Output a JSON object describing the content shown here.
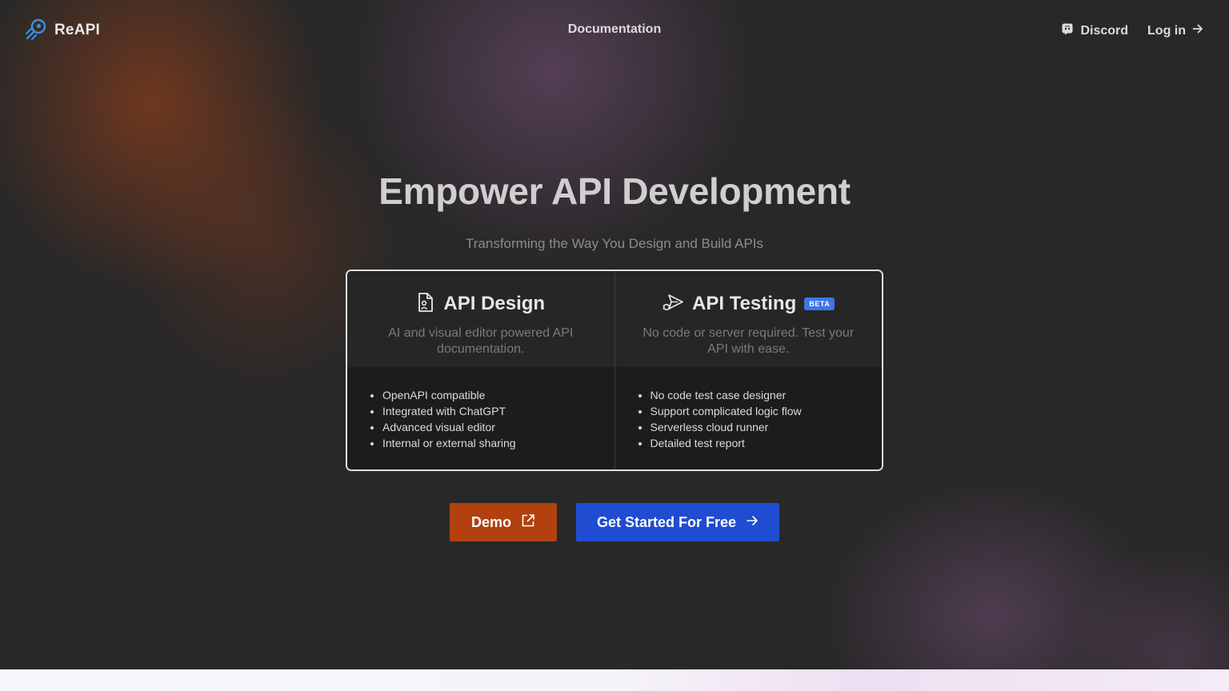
{
  "nav": {
    "logo_text": "ReAPI",
    "documentation": "Documentation",
    "discord": "Discord",
    "login": "Log in"
  },
  "hero": {
    "title": "Empower API Development",
    "subtitle": "Transforming the Way You Design and Build APIs"
  },
  "features": [
    {
      "icon": "document-user-icon",
      "title": "API Design",
      "description": "AI and visual editor powered API documentation.",
      "bullets": [
        "OpenAPI compatible",
        "Integrated with ChatGPT",
        "Advanced visual editor",
        "Internal or external sharing"
      ]
    },
    {
      "icon": "bug-send-icon",
      "title": "API Testing",
      "badge": "BETA",
      "description": "No code or server required. Test your API with ease.",
      "bullets": [
        "No code test case designer",
        "Support complicated logic flow",
        "Serverless cloud runner",
        "Detailed test report"
      ]
    }
  ],
  "buttons": {
    "demo": "Demo",
    "get_started": "Get Started For Free"
  },
  "colors": {
    "background": "#282828",
    "demo_button": "#b2410f",
    "get_started_button": "#1f4cd1",
    "beta_badge": "#3b76ea",
    "logo_accent": "#3a8fe0"
  }
}
